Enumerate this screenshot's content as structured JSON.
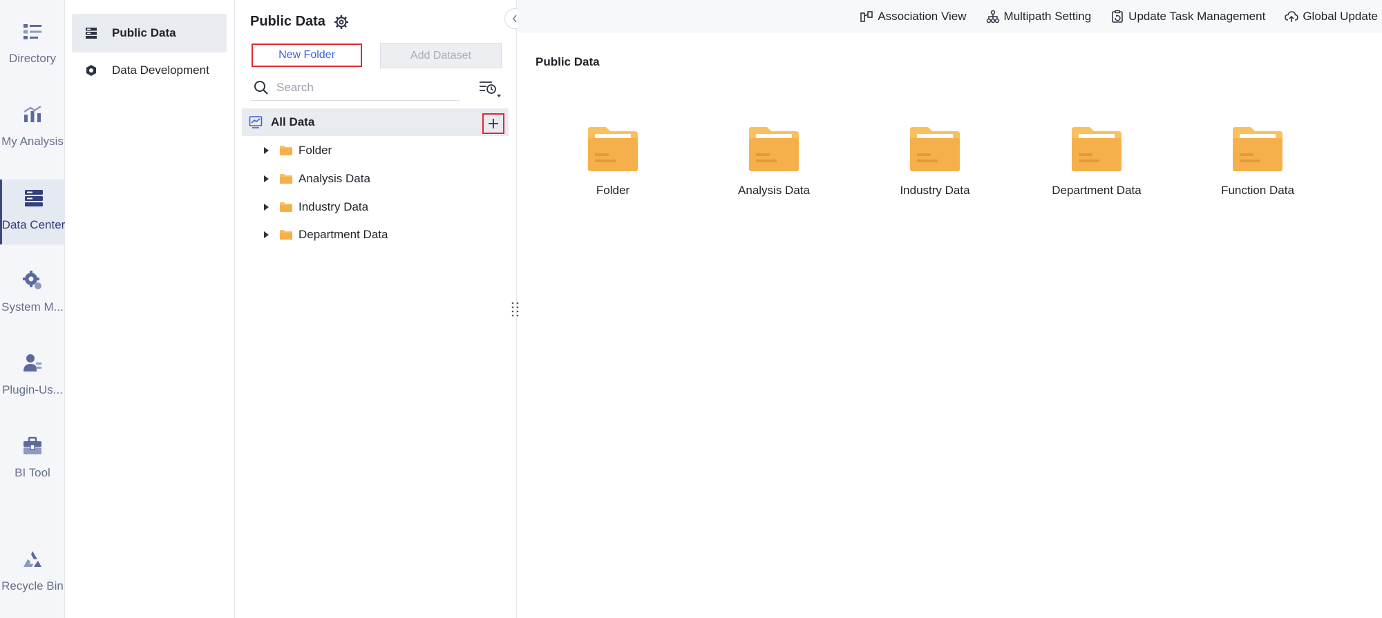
{
  "nav": {
    "items": [
      {
        "label": "Directory",
        "icon": "directory-icon"
      },
      {
        "label": "My Analysis",
        "icon": "analysis-chart-icon"
      },
      {
        "label": "Data Center",
        "icon": "data-center-icon",
        "active": true
      },
      {
        "label": "System M...",
        "icon": "system-gear-icon"
      },
      {
        "label": "Plugin-Us...",
        "icon": "plugin-user-icon"
      },
      {
        "label": "BI Tool",
        "icon": "toolbox-icon"
      },
      {
        "label": "Recycle Bin",
        "icon": "recycle-bin-icon"
      }
    ]
  },
  "subnav": {
    "items": [
      {
        "label": "Public Data",
        "icon": "public-data-icon",
        "active": true
      },
      {
        "label": "Data Development",
        "icon": "data-development-icon"
      }
    ]
  },
  "tree_panel": {
    "title": "Public Data",
    "new_folder_label": "New Folder",
    "add_dataset_label": "Add Dataset",
    "search_placeholder": "Search",
    "root_label": "All Data",
    "items": [
      "Folder",
      "Analysis Data",
      "Industry Data",
      "Department Data"
    ]
  },
  "toolbar": {
    "association_view": "Association View",
    "multipath_setting": "Multipath Setting",
    "update_task_management": "Update Task Management",
    "global_update": "Global Update"
  },
  "main": {
    "title": "Public Data",
    "folders": [
      "Folder",
      "Analysis Data",
      "Industry Data",
      "Department Data",
      "Function Data"
    ]
  },
  "colors": {
    "accent_blue": "#3a63d6",
    "highlight_red": "#e3282f",
    "folder_yellow": "#f5b04c",
    "nav_icon": "#5b6a9b"
  }
}
